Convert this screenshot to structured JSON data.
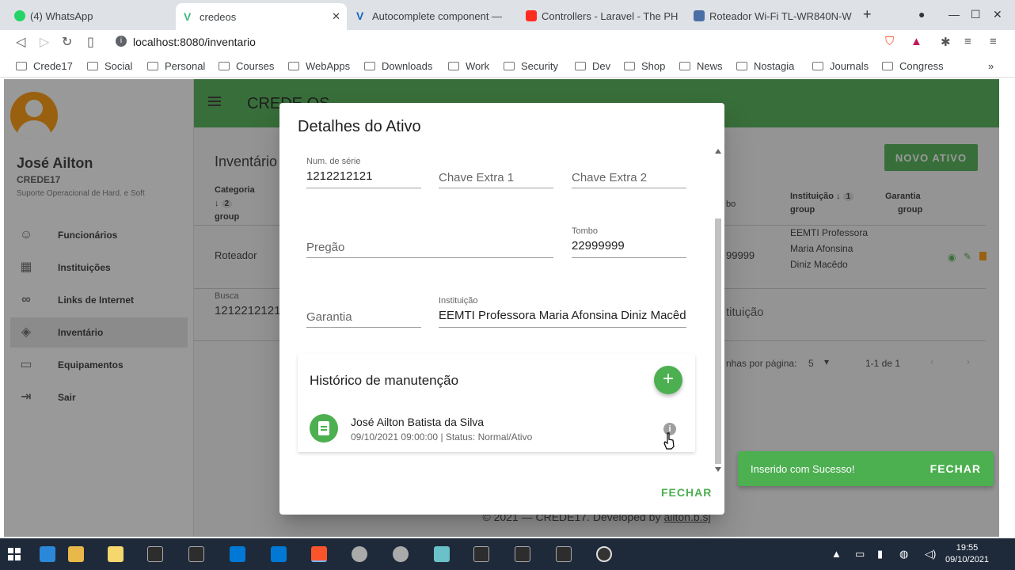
{
  "browser": {
    "tabs": [
      {
        "label": "(4) WhatsApp",
        "color": "#25d366"
      },
      {
        "label": "credeos",
        "color": "#41b883"
      },
      {
        "label": "Autocomplete component —",
        "color": "#1867c0"
      },
      {
        "label": "Controllers - Laravel - The PH",
        "color": "#ff2d20"
      },
      {
        "label": "Roteador Wi-Fi TL-WR840N-W",
        "color": "#4a6fa5"
      }
    ],
    "new_tab": "+",
    "url": "localhost:8080/inventario",
    "bookmarks": [
      "Crede17",
      "Social",
      "Personal",
      "Courses",
      "WebApps",
      "Downloads",
      "Work",
      "Security",
      "Dev",
      "Shop",
      "News",
      "Nostagia",
      "Journals",
      "Congress"
    ],
    "more": "»"
  },
  "drawer": {
    "user_name": "José Ailton",
    "org": "CREDE17",
    "role": "Suporte Operacional de Hard. e Soft",
    "items": [
      {
        "label": "Funcionários",
        "icon": "person-icon"
      },
      {
        "label": "Instituições",
        "icon": "building-icon"
      },
      {
        "label": "Links de Internet",
        "icon": "link-icon"
      },
      {
        "label": "Inventário",
        "icon": "tag-icon"
      },
      {
        "label": "Equipamentos",
        "icon": "equipment-icon"
      },
      {
        "label": "Sair",
        "icon": "logout-icon"
      }
    ]
  },
  "appbar": {
    "brand": "CREDE OS"
  },
  "main": {
    "title": "Inventário",
    "novo_button": "NOVO ATIVO",
    "col_categoria": "Categoria",
    "col_categoria_sort": "2",
    "col_group": "group",
    "col_instituicao": "Instituição",
    "col_instituicao_sort": "1",
    "col_garantia": "Garantia",
    "col_tombo_fragment": "bo",
    "row_categoria": "Roteador",
    "row_tombo_fragment": "99999",
    "row_instituicao": "EEMTI Professora Maria Afonsina Diniz Macêdo",
    "busca_label": "Busca",
    "busca_value": "1212212121",
    "instituicao_filter": "tituição",
    "per_page_label": "nhas por página:",
    "per_page_value": "5",
    "range": "1-1 de 1",
    "footer_prefix": "© 2021 — CREDE17. Developed by",
    "footer_link": "ailton.b.sj"
  },
  "dialog": {
    "title": "Detalhes do Ativo",
    "fields": {
      "num_serie_label": "Num. de série",
      "num_serie_value": "1212212121",
      "chave_extra1": "Chave Extra 1",
      "chave_extra2": "Chave Extra 2",
      "pregao": "Pregão",
      "tombo_label": "Tombo",
      "tombo_value": "22999999",
      "garantia": "Garantia",
      "instituicao_label": "Instituição",
      "instituicao_value": "EEMTI Professora Maria Afonsina Diniz Macêdo"
    },
    "historico": {
      "title": "Histórico de manutenção",
      "add": "+",
      "entry_name": "José Ailton Batista da Silva",
      "entry_detail": "09/10/2021 09:00:00 | Status: Normal/Ativo"
    },
    "close_button": "FECHAR"
  },
  "snackbar": {
    "text": "Inserido com Sucesso!",
    "button": "FECHAR"
  },
  "taskbar": {
    "time": "19:55",
    "date": "09/10/2021"
  }
}
